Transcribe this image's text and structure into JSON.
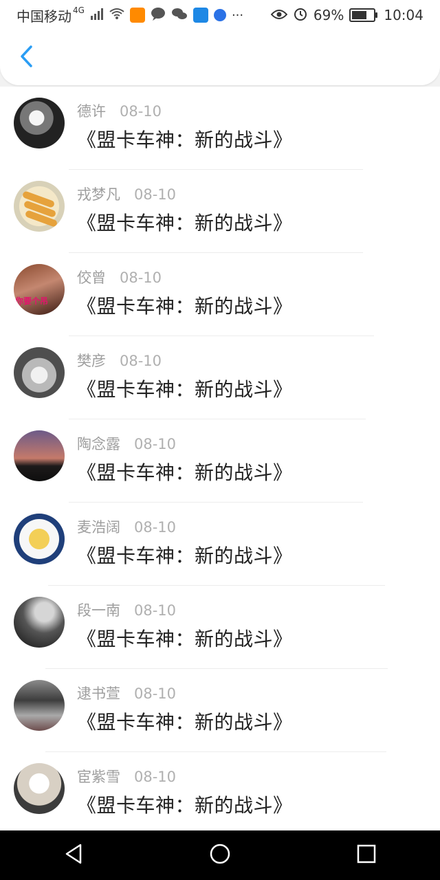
{
  "status_bar": {
    "carrier": "中国移动",
    "network_type": "4G",
    "battery_percent": "69%",
    "battery_level": 0.69,
    "time": "10:04"
  },
  "header": {
    "back_icon": "chevron-left-icon",
    "accent_color": "#2a9df4"
  },
  "list": {
    "items": [
      {
        "name": "德许",
        "date": "08-10",
        "title": "《盟卡车神：新的战斗》"
      },
      {
        "name": "戎梦凡",
        "date": "08-10",
        "title": "《盟卡车神：新的战斗》"
      },
      {
        "name": "佼曾",
        "date": "08-10",
        "title": "《盟卡车神：新的战斗》"
      },
      {
        "name": "樊彦",
        "date": "08-10",
        "title": "《盟卡车神：新的战斗》"
      },
      {
        "name": "陶念露",
        "date": "08-10",
        "title": "《盟卡车神：新的战斗》"
      },
      {
        "name": "麦浩阔",
        "date": "08-10",
        "title": "《盟卡车神：新的战斗》"
      },
      {
        "name": "段一南",
        "date": "08-10",
        "title": "《盟卡车神：新的战斗》"
      },
      {
        "name": "逮书萱",
        "date": "08-10",
        "title": "《盟卡车神：新的战斗》"
      },
      {
        "name": "宦紫雪",
        "date": "08-10",
        "title": "《盟卡车神：新的战斗》"
      }
    ]
  },
  "avatar_overlay_text": "你要个吊",
  "navbar": {
    "back_icon": "triangle-back-icon",
    "home_icon": "circle-home-icon",
    "recents_icon": "square-recents-icon"
  }
}
